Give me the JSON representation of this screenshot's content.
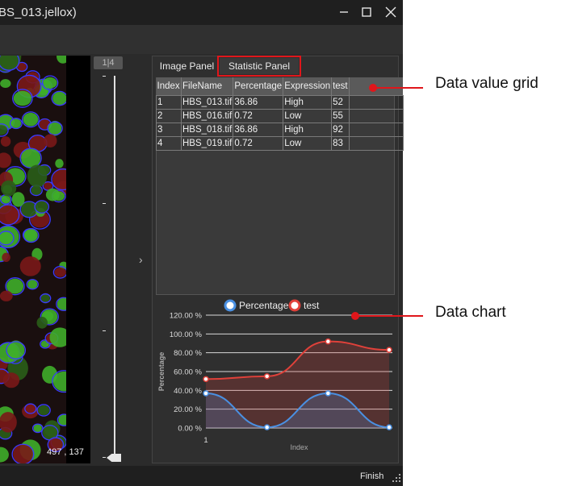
{
  "window": {
    "title": "BS_013.jellox)",
    "controls": [
      "minimize-icon",
      "maximize-icon",
      "close-icon"
    ]
  },
  "viewer": {
    "page_indicator": "1|4",
    "coordinates": "497 , 137",
    "slider_position": 1.0
  },
  "tabs": [
    {
      "label": "Image Panel",
      "active": false
    },
    {
      "label": "Statistic Panel",
      "active": true
    }
  ],
  "grid": {
    "columns": [
      "Index",
      "FileName",
      "Percentage",
      "Expression",
      "test"
    ],
    "rows": [
      [
        "1",
        "HBS_013.tif",
        "36.86",
        "High",
        "52"
      ],
      [
        "2",
        "HBS_016.tif",
        "0.72",
        "Low",
        "55"
      ],
      [
        "3",
        "HBS_018.tif",
        "36.86",
        "High",
        "92"
      ],
      [
        "4",
        "HBS_019.tif",
        "0.72",
        "Low",
        "83"
      ]
    ]
  },
  "chart_data": {
    "type": "area",
    "categories": [
      "1",
      "2",
      "3",
      "4"
    ],
    "x_tick_labels": [
      "1"
    ],
    "series": [
      {
        "name": "Percentage",
        "values": [
          36.86,
          0.72,
          36.86,
          0.72
        ],
        "color": "#4a90e2"
      },
      {
        "name": "test",
        "values": [
          52,
          55,
          92,
          83
        ],
        "color": "#e0413a"
      }
    ],
    "xlabel": "Index",
    "ylabel": "Percentage",
    "ylim": [
      0,
      120
    ],
    "y_tick_labels": [
      "120.00 %",
      "100.00 %",
      "80.00 %",
      "60.00 %",
      "40.00 %",
      "20.00 %",
      "0.00 %"
    ],
    "grid": true,
    "legend_position": "top"
  },
  "status": {
    "finish_label": "Finish"
  },
  "annotations": {
    "grid_label": "Data value grid",
    "chart_label": "Data chart",
    "color": "#e0161b"
  }
}
